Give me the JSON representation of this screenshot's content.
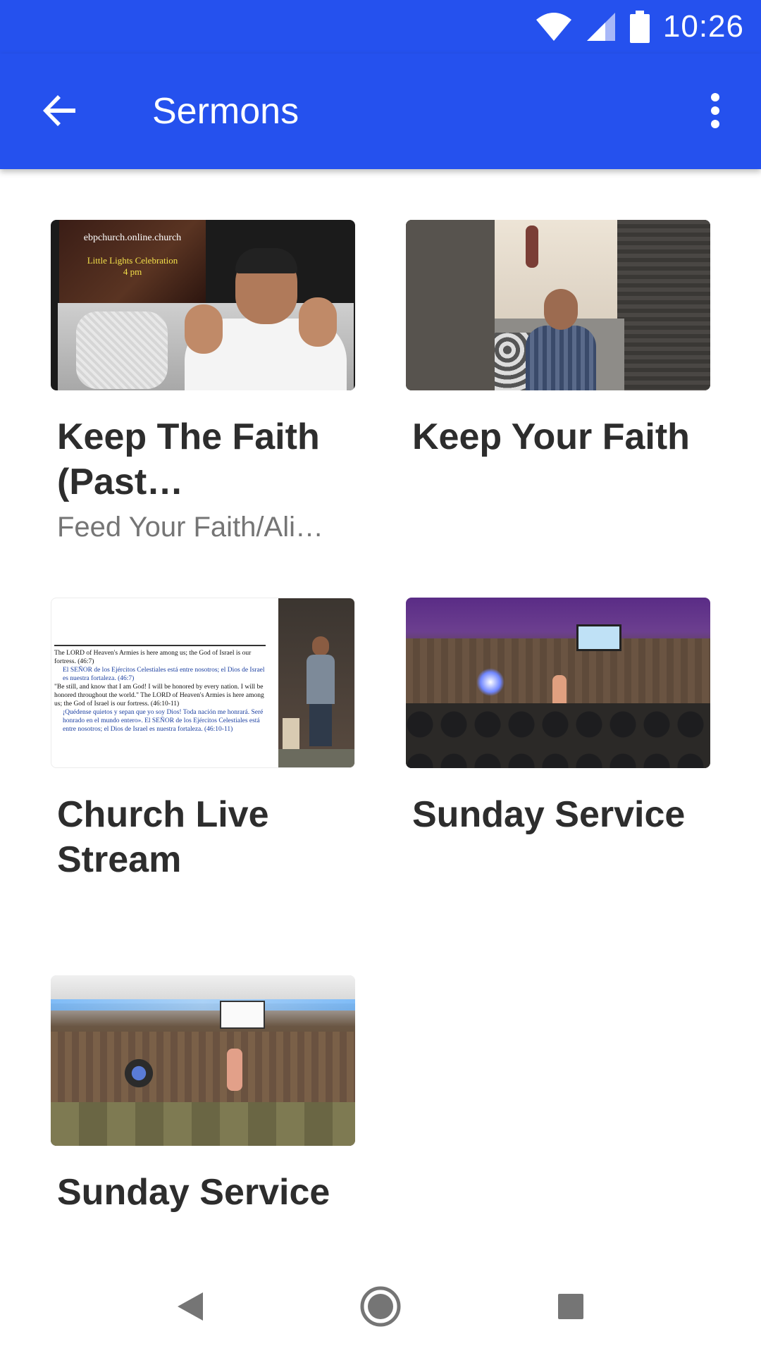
{
  "status_bar": {
    "time": "10:26",
    "icons": [
      "wifi-icon",
      "cell-signal-icon",
      "battery-icon"
    ]
  },
  "app_bar": {
    "title": "Sermons",
    "back_icon": "arrow-back-icon",
    "menu_icon": "more-vert-icon",
    "color": "#2551ee"
  },
  "sermons": [
    {
      "title": "Keep The Faith (Past Experiences)",
      "subtitle": "Feed Your Faith/Alimenta Tu Fe",
      "thumb_text": [
        "ebpchurch.online.church",
        "Little Lights Celebration",
        "4 pm"
      ]
    },
    {
      "title": "Keep Your Faith",
      "subtitle": ""
    },
    {
      "title": "Church Live Stream",
      "subtitle": "",
      "thumb_text": [
        "The LORD of Heaven's Armies is here among us; the God of Israel is our fortress. (46:7)",
        "El SEÑOR de los Ejércitos Celestiales está entre nosotros; el Dios de Israel es nuestra fortaleza. (46:7)",
        "\"Be still, and know that I am God! I will be honored by every nation. I will be honored throughout the world.\" The LORD of Heaven's Armies is here among us; the God of Israel is our fortress. (46:10-11)",
        "¡Quédense quietos y sepan que yo soy Dios! Toda nación me honrará. Seré honrado en el mundo entero». El SEÑOR de los Ejércitos Celestiales está entre nosotros; el Dios de Israel es nuestra fortaleza. (46:10-11)"
      ]
    },
    {
      "title": "Sunday Service",
      "subtitle": ""
    },
    {
      "title": "Sunday Service",
      "subtitle": ""
    }
  ],
  "nav": {
    "back_icon": "nav-back-icon",
    "home_icon": "nav-home-icon",
    "recents_icon": "nav-recents-icon"
  }
}
